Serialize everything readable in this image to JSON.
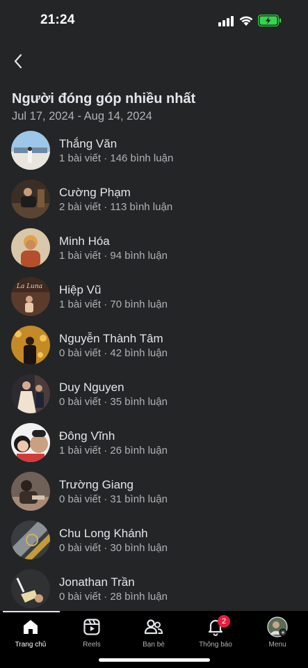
{
  "status_bar": {
    "time": "21:24"
  },
  "header": {
    "title": "Người đóng góp nhiều nhất",
    "date_range": "Jul 17, 2024 - Aug 14, 2024"
  },
  "contributors": [
    {
      "name": "Thắng Văn",
      "stats": "1 bài viết · 146 bình luận"
    },
    {
      "name": "Cường Phạm",
      "stats": "2 bài viết · 113 bình luận"
    },
    {
      "name": "Minh Hóa",
      "stats": "1 bài viết · 94 bình luận"
    },
    {
      "name": "Hiệp Vũ",
      "stats": "1 bài viết · 70 bình luận"
    },
    {
      "name": "Nguyễn Thành Tâm",
      "stats": "0 bài viết · 42 bình luận"
    },
    {
      "name": "Duy Nguyen",
      "stats": "0 bài viết · 35 bình luận"
    },
    {
      "name": "Đông Vĩnh",
      "stats": "1 bài viết · 26 bình luận"
    },
    {
      "name": "Trường Giang",
      "stats": "0 bài viết · 31 bình luận"
    },
    {
      "name": "Chu Long Khánh",
      "stats": "0 bài viết · 30 bình luận"
    },
    {
      "name": "Jonathan Trần",
      "stats": "0 bài viết · 28 bình luận"
    }
  ],
  "tab_bar": {
    "home": "Trang chủ",
    "reels": "Reels",
    "friends": "Bạn bè",
    "notifications": "Thông báo",
    "notifications_count": "2",
    "menu": "Menu"
  },
  "colors": {
    "background": "#242526",
    "primary_text": "#e4e6eb",
    "secondary_text": "#b0b3b8",
    "tab_bar": "#000000",
    "badge": "#e41e3f",
    "battery": "#32d74b"
  },
  "icons": [
    "back-arrow-icon",
    "signal-icon",
    "wifi-icon",
    "battery-charging-icon",
    "home-icon",
    "reels-icon",
    "friends-icon",
    "bell-icon",
    "profile-avatar-icon"
  ]
}
